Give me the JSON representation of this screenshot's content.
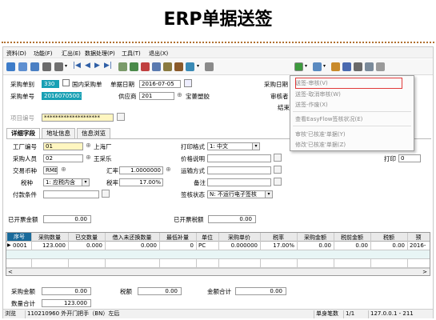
{
  "page_title": "ERP单据送签",
  "menu": [
    "资料(D)",
    "功能(F)",
    "汇出(E)",
    "数据处理(P)",
    "工具(T)",
    "退出(X)"
  ],
  "form": {
    "purchase_type_label": "采购单别",
    "purchase_type_value": "330",
    "domestic_label": "国内采购单",
    "order_date_label": "单据日期",
    "order_date_value": "2016-07-05",
    "purchase_date_label": "采购日期",
    "purchase_no_label": "采购单号",
    "purchase_no_value": "20160705001",
    "supplier_label": "供应商",
    "supplier_code": "201",
    "supplier_name": "宝萎塑胶",
    "approver_label": "审核者",
    "end_label": "结束",
    "project_label": "项目编号",
    "project_value": "********************",
    "tab_detail": "详细字段",
    "tab_address": "地址信息",
    "tab_info": "信息浏览",
    "factory_label": "工厂编号",
    "factory_code": "01",
    "factory_name": "上海厂",
    "print_format_label": "打印格式",
    "print_format_value": "1: 中文",
    "print_label": "打印",
    "print_value": "0",
    "buyer_label": "采购人员",
    "buyer_code": "02",
    "buyer_name": "王采乐",
    "price_note_label": "价格说明",
    "currency_label": "交易币种",
    "currency_value": "RMB",
    "rate_label": "汇率",
    "rate_value": "1.0000000",
    "transport_label": "运输方式",
    "tax_type_label": "税种",
    "tax_type_value": "1: 应税内含",
    "tax_rate_label": "税率",
    "tax_rate_value": "17.00%",
    "remark_label": "备注",
    "payment_label": "付款条件",
    "sign_status_label": "签核状态",
    "sign_status_value": "N: 不运行电子签核",
    "invoiced_amount_label": "已开票金额",
    "invoiced_amount_value": "0.00",
    "invoiced_tax_label": "已开票税额",
    "invoiced_tax_value": "0.00"
  },
  "context_menu": {
    "items": [
      "送签-审核(V)",
      "送签-取消审核(W)",
      "送签-作废(X)",
      "查看EasyFlow签核状况(E)",
      "审核'已核准'单据(Y)",
      "修改'已核准'单据(Z)"
    ]
  },
  "grid": {
    "headers": [
      "序号",
      "采购数量",
      "已交数量",
      "借入未还换数量",
      "最低补量",
      "单位",
      "采购单价",
      "税率",
      "采购金额",
      "税前金额",
      "税额",
      "预"
    ],
    "rows": [
      [
        "0001",
        "123.000",
        "0.000",
        "0.000",
        "0",
        "PC",
        "0.000000",
        "17.00%",
        "0.00",
        "0.00",
        "0.00",
        "2016-"
      ]
    ]
  },
  "summary": {
    "amount_label": "采购金额",
    "amount_value": "0.00",
    "tax_label": "税额",
    "tax_value": "0.00",
    "total_label": "金额合计",
    "total_value": "0.00",
    "qty_label": "数量合计",
    "qty_value": "123.000"
  },
  "status": {
    "mode": "浏览",
    "item_text": "110210960 外开门把手（BN）左后",
    "record_label": "单身笔数",
    "record_value": "1/1",
    "version": "127.0.0.1 - 211"
  }
}
